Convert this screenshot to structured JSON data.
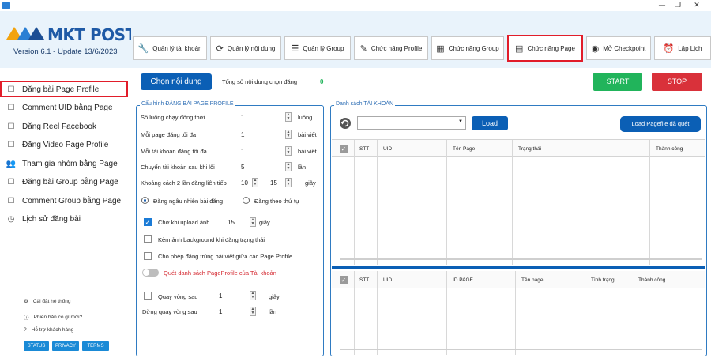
{
  "window": {
    "minimize": "—",
    "restore": "❐",
    "close": "✕"
  },
  "brand": {
    "name": "MKT POST",
    "version": "Version  6.1  - Update  13/6/2023"
  },
  "tabs": [
    {
      "label": "Quản lý tài khoản",
      "icon": "🔧"
    },
    {
      "label": "Quản lý nội dung",
      "icon": "⟳"
    },
    {
      "label": "Quản lý Group",
      "icon": "☰"
    },
    {
      "label": "Chức năng Profile",
      "icon": "✎"
    },
    {
      "label": "Chức năng Group",
      "icon": "▦"
    },
    {
      "label": "Chức năng Page",
      "icon": "▤"
    },
    {
      "label": "Mở Checkpoint",
      "icon": "◉"
    },
    {
      "label": "Lập Lịch",
      "icon": "⏰"
    }
  ],
  "sidebar": {
    "items": [
      {
        "label": "Đăng bài Page Profile",
        "icon": "☐"
      },
      {
        "label": "Comment UID bằng Page",
        "icon": "☐"
      },
      {
        "label": "Đăng Reel Facebook",
        "icon": "☐"
      },
      {
        "label": "Đăng Video Page Profile",
        "icon": "☐"
      },
      {
        "label": "Tham gia nhóm bằng Page",
        "icon": "👥"
      },
      {
        "label": "Đăng bài Group bằng Page",
        "icon": "☐"
      },
      {
        "label": "Comment Group bằng Page",
        "icon": "☐"
      },
      {
        "label": "Lịch sử đăng bài",
        "icon": "◷"
      }
    ],
    "footer": [
      {
        "label": "Cài đặt hệ thống",
        "icon": "⚙"
      },
      {
        "label": "Phiên bản có gì mới?",
        "icon": "ⓘ"
      },
      {
        "label": "Hỗ trợ khách hàng",
        "icon": "?"
      }
    ],
    "pills": [
      "STATUS",
      "PRIVACY",
      "TERMS"
    ]
  },
  "toolbar": {
    "choose_content": "Chọn nội dung",
    "total_label": "Tổng số nội dung chọn đăng",
    "total_value": "0",
    "start": "START",
    "stop": "STOP"
  },
  "config": {
    "legend": "Cấu hình ĐĂNG BÀI PAGE PROFILE",
    "rows": [
      {
        "label": "Số luồng chạy đồng thời",
        "value": "1",
        "unit": "luồng"
      },
      {
        "label": "Mỗi page đăng tối đa",
        "value": "1",
        "unit": "bài viết"
      },
      {
        "label": "Mỗi tài khoản đăng tối đa",
        "value": "1",
        "unit": "bài viết"
      },
      {
        "label": "Chuyển tài khoản sau khi lỗi",
        "value": "5",
        "unit": "lần"
      }
    ],
    "delay": {
      "label": "Khoảng cách 2 lần đăng liên tiếp",
      "from": "10",
      "to": "15",
      "unit": "giây"
    },
    "radio_random": "Đăng ngẫu nhiên bài đăng",
    "radio_order": "Đăng theo thứ tự",
    "wait_upload": {
      "label": "Chờ khi upload ảnh",
      "value": "15",
      "unit": "giây"
    },
    "bg_image": "Kèm ảnh background khi đăng trạng thái",
    "allow_dup": "Cho phép đăng trùng bài viết giữa các Page Profile",
    "scan_toggle": "Quét danh sách PageProfile của Tài khoản",
    "loop": {
      "label": "Quay vòng sau",
      "value": "1",
      "unit": "giây"
    },
    "stop_loop": {
      "label": "Dừng quay vòng sau",
      "value": "1",
      "unit": "lần"
    }
  },
  "accounts": {
    "legend": "Danh sách TÀI KHOẢN",
    "load": "Load",
    "load_pagefile": "Load Pagefile đã quét",
    "table1_headers": [
      "STT",
      "UID",
      "Tên Page",
      "Trạng thái",
      "Thành công"
    ],
    "table2_headers": [
      "STT",
      "UID",
      "ID PAGE",
      "Tên page",
      "Tình trạng",
      "Thành công"
    ]
  },
  "colors": {
    "accent": "#0b5fb5",
    "start": "#21b45b",
    "stop": "#d9313a",
    "highlight": "#e11d2a",
    "toggle_label": "#d4262e"
  }
}
